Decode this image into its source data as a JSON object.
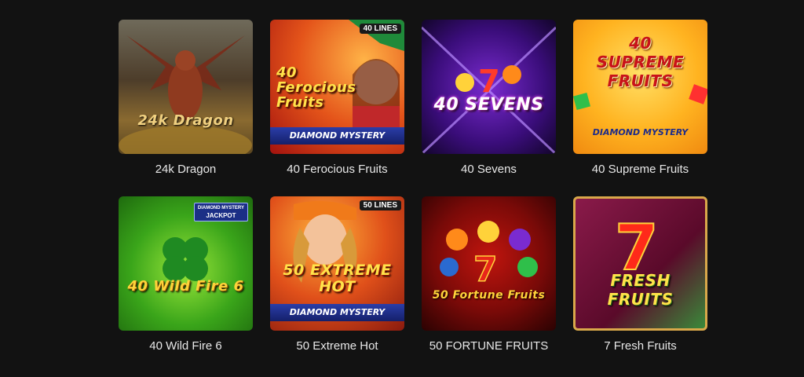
{
  "games": [
    {
      "title": "24k Dragon",
      "art_text": "24k Dragon"
    },
    {
      "title": "40 Ferocious Fruits",
      "art_text": [
        "40",
        "Ferocious",
        "Fruits"
      ],
      "tag": "40 LINES",
      "badge": "DIAMOND MYSTERY"
    },
    {
      "title": "40 Sevens",
      "art_text": "40 SEVENS"
    },
    {
      "title": "40 Supreme Fruits",
      "art_text": [
        "40",
        "SUPREME",
        "FRUITS"
      ],
      "badge": "DIAMOND MYSTERY"
    },
    {
      "title": "40 Wild Fire 6",
      "art_text": "40 Wild Fire 6",
      "jackpot": [
        "DIAMOND MYSTERY",
        "JACKPOT"
      ]
    },
    {
      "title": "50 Extreme Hot",
      "art_text": [
        "50 EXTREME",
        "HOT"
      ],
      "tag": "50 LINES",
      "badge": "DIAMOND MYSTERY"
    },
    {
      "title": "50 FORTUNE FRUITS",
      "art_text": "50 Fortune Fruits"
    },
    {
      "title": "7 Fresh Fruits",
      "art_text": [
        "7",
        "FRESH FRUITS"
      ]
    }
  ],
  "icons": {
    "dragon": "dragon-icon",
    "clover": "clover-icon",
    "seven": "seven-icon"
  }
}
